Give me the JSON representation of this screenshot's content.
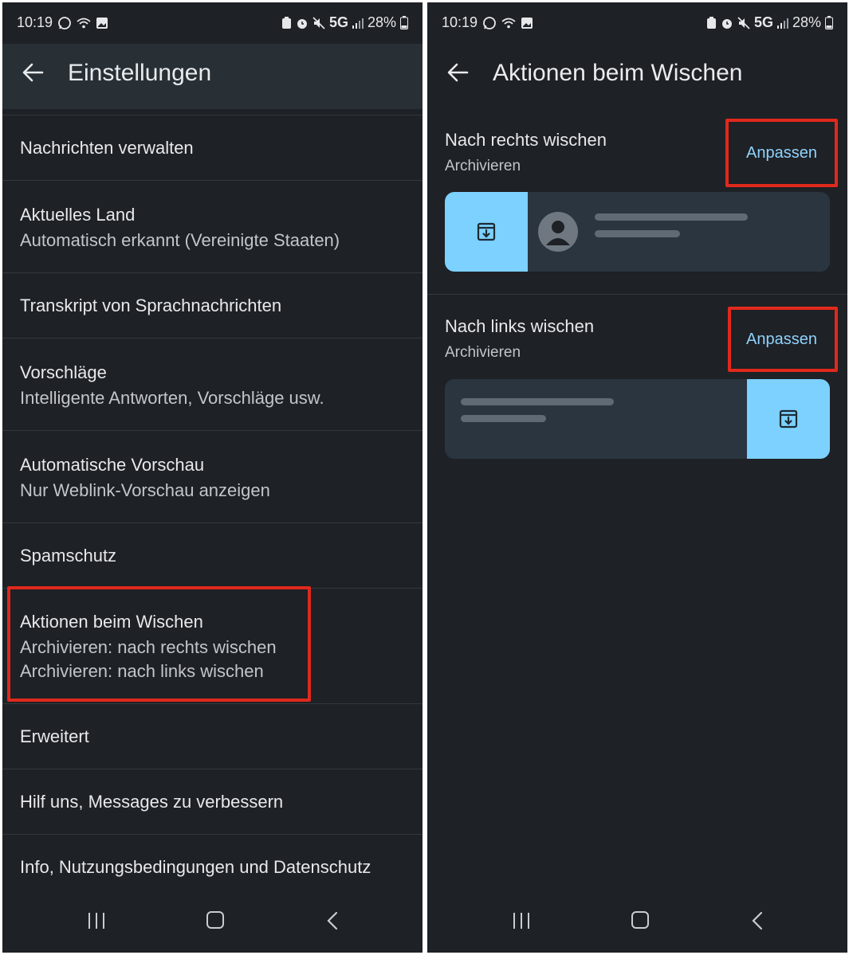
{
  "status_bar": {
    "time": "10:19",
    "network": "5G",
    "battery": "28%"
  },
  "left": {
    "title": "Einstellungen",
    "items": [
      {
        "title": "Nachrichten verwalten"
      },
      {
        "title": "Aktuelles Land",
        "subtitle": "Automatisch erkannt (Vereinigte Staaten)"
      },
      {
        "title": "Transkript von Sprachnachrichten"
      },
      {
        "title": "Vorschläge",
        "subtitle": "Intelligente Antworten, Vorschläge usw."
      },
      {
        "title": "Automatische Vorschau",
        "subtitle": "Nur Weblink-Vorschau anzeigen"
      },
      {
        "title": "Spamschutz"
      },
      {
        "title": "Aktionen beim Wischen",
        "subtitle": "Archivieren: nach rechts wischen",
        "subtitle2": "Archivieren: nach links wischen"
      },
      {
        "title": "Erweitert"
      },
      {
        "title": "Hilf uns, Messages zu verbessern"
      },
      {
        "title": "Info, Nutzungsbedingungen und Datenschutz"
      }
    ]
  },
  "right": {
    "title": "Aktionen beim Wischen",
    "swipe_right": {
      "title": "Nach rechts wischen",
      "action": "Archivieren",
      "button": "Anpassen"
    },
    "swipe_left": {
      "title": "Nach links wischen",
      "action": "Archivieren",
      "button": "Anpassen"
    }
  },
  "colors": {
    "background": "#1e2125",
    "accent": "#7cd1ff",
    "link": "#8fd3ff",
    "highlight": "#e0291c"
  },
  "icons": [
    "whatsapp-icon",
    "wifi-icon",
    "image-icon",
    "battery-saver-icon",
    "alarm-icon",
    "mute-icon",
    "signal-icon",
    "battery-icon",
    "back-arrow-icon",
    "archive-icon",
    "avatar-icon",
    "nav-recents-icon",
    "nav-home-icon",
    "nav-back-icon"
  ]
}
